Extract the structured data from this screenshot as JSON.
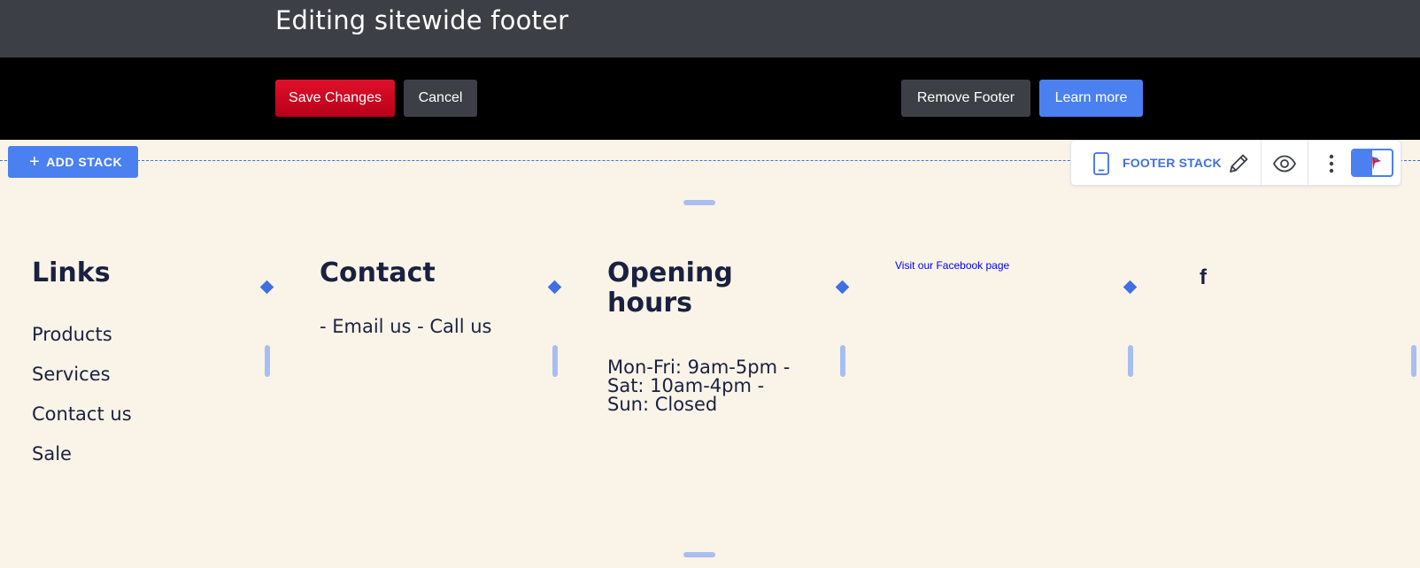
{
  "header": {
    "title": "Editing sitewide footer"
  },
  "actions": {
    "save_label": "Save Changes",
    "cancel_label": "Cancel",
    "remove_label": "Remove Footer",
    "learn_label": "Learn more"
  },
  "editor": {
    "add_stack_label": "ADD STACK",
    "stack_toolbar": {
      "label": "FOOTER STACK",
      "icons": [
        "phone-icon",
        "pencil-icon",
        "eye-icon",
        "more-vertical-icon",
        "app-logo-icon"
      ]
    }
  },
  "footer": {
    "links": {
      "heading": "Links",
      "items": [
        "Products",
        "Services",
        "Contact us",
        "Sale"
      ]
    },
    "contact": {
      "heading": "Contact",
      "text": "- Email us - Call us"
    },
    "hours": {
      "heading": "Opening hours",
      "text": "Mon-Fri: 9am-5pm - Sat: 10am-4pm - Sun: Closed"
    },
    "social": {
      "link_text": "Visit our Facebook page",
      "icon_glyph": "f"
    }
  },
  "colors": {
    "topbar": "#3c3f46",
    "save": "#d00020",
    "accent": "#4a80f0",
    "canvas": "#faf4e8",
    "text": "#1a2140"
  }
}
